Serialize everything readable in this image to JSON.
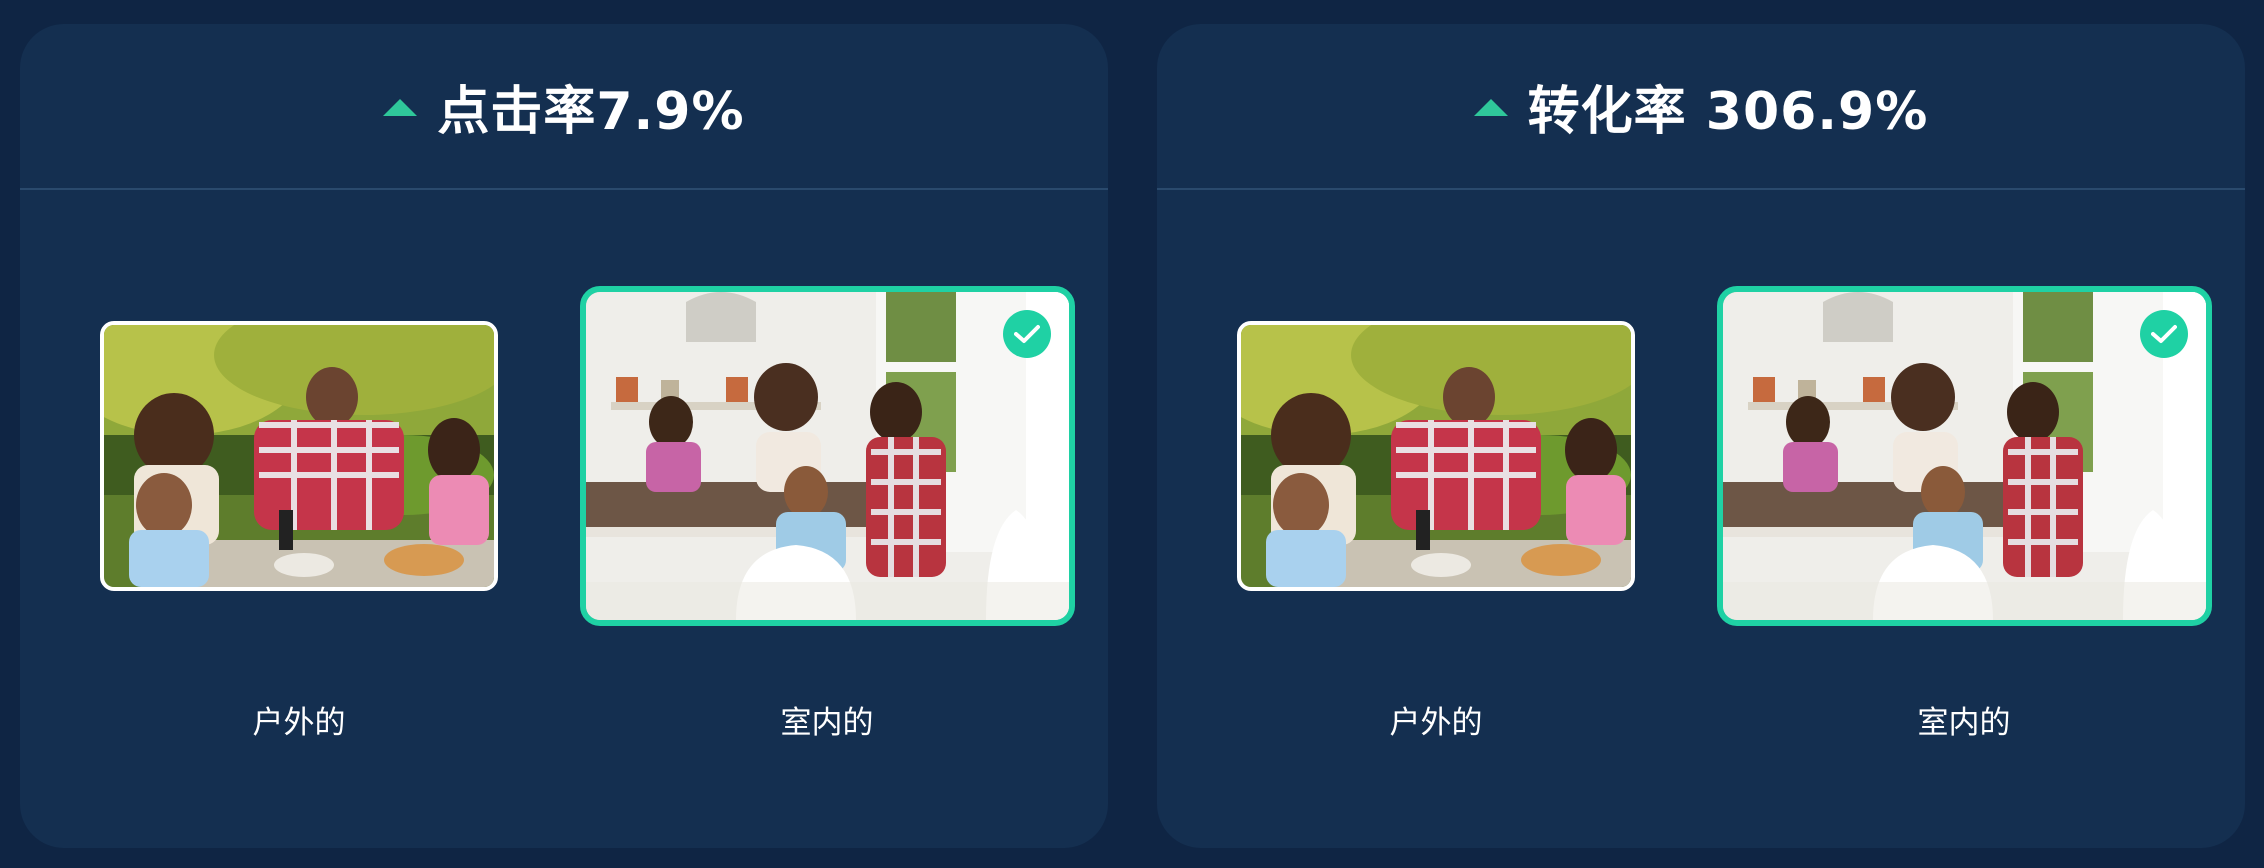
{
  "panels": [
    {
      "title": "点击率7.9%",
      "trend": "up",
      "options": [
        {
          "label": "户外的",
          "selected": false,
          "photo": "family-dining-outdoor"
        },
        {
          "label": "室内的",
          "selected": true,
          "photo": "family-dining-indoor"
        }
      ]
    },
    {
      "title": "转化率 306.9%",
      "trend": "up",
      "options": [
        {
          "label": "户外的",
          "selected": false,
          "photo": "family-dining-outdoor"
        },
        {
          "label": "室内的",
          "selected": true,
          "photo": "family-dining-indoor"
        }
      ]
    }
  ],
  "colors": {
    "background": "#0f2544",
    "panel": "#142f50",
    "accent": "#1fd1a4",
    "trend_up": "#2fc79a",
    "text": "#ffffff"
  }
}
